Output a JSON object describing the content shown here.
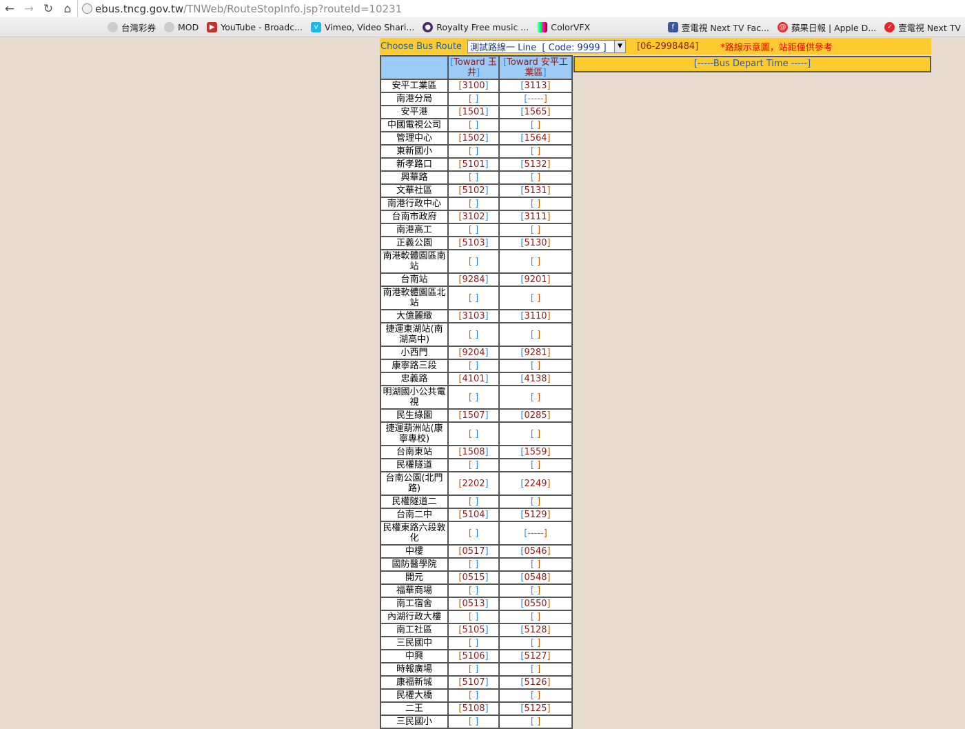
{
  "browser": {
    "url_host": "ebus.tncg.gov.tw",
    "url_path": "/TNWeb/RouteStopInfo.jsp?routeId=10231",
    "bookmarks": [
      "台灣彩券",
      "MOD",
      "YouTube - Broadc...",
      "Vimeo, Video Shari...",
      "Royalty Free music ...",
      "ColorVFX"
    ],
    "bookmarks_right": [
      "壹電視 Next TV Fac...",
      "蘋果日報 | Apple D...",
      "壹電視 Next TV"
    ]
  },
  "topbar": {
    "label": "Choose Bus Route",
    "route_selected": "測試路線一 Line  [ Code: 9999 ]",
    "phone": "[06-2998484]",
    "notice": "*路線示意圖，站距僅供參考"
  },
  "table": {
    "headers": [
      "",
      "Toward 玉井",
      "Toward 安平工業區"
    ],
    "rows": [
      [
        "安平工業區",
        "3100",
        "3113"
      ],
      [
        "南港分局",
        " ",
        "-----"
      ],
      [
        "安平港",
        "1501",
        "1565"
      ],
      [
        "中國電視公司",
        " ",
        " "
      ],
      [
        "管理中心",
        "1502",
        "1564"
      ],
      [
        "東新國小",
        " ",
        " "
      ],
      [
        "新孝路口",
        "5101",
        "5132"
      ],
      [
        "興華路",
        " ",
        " "
      ],
      [
        "文華社區",
        "5102",
        "5131"
      ],
      [
        "南港行政中心",
        " ",
        " "
      ],
      [
        "台南市政府",
        "3102",
        "3111"
      ],
      [
        "南港高工",
        " ",
        " "
      ],
      [
        "正義公園",
        "5103",
        "5130"
      ],
      [
        "南港軟體園區南站",
        " ",
        " "
      ],
      [
        "台南站",
        "9284",
        "9201"
      ],
      [
        "南港軟體園區北站",
        " ",
        " "
      ],
      [
        "大億麗緻",
        "3103",
        "3110"
      ],
      [
        "捷運東湖站(南湖高中)",
        " ",
        " "
      ],
      [
        "小西門",
        "9204",
        "9281"
      ],
      [
        "康寧路三段",
        " ",
        " "
      ],
      [
        "忠義路",
        "4101",
        "4138"
      ],
      [
        "明湖國小公共電視",
        " ",
        " "
      ],
      [
        "民生綠園",
        "1507",
        "0285"
      ],
      [
        "捷運葫洲站(康寧專校)",
        " ",
        " "
      ],
      [
        "台南東站",
        "1508",
        "1559"
      ],
      [
        "民權隧道",
        " ",
        " "
      ],
      [
        "台南公園(北門路)",
        "2202",
        "2249"
      ],
      [
        "民權隧道二",
        " ",
        " "
      ],
      [
        "台南二中",
        "5104",
        "5129"
      ],
      [
        "民權東路六段敦化",
        " ",
        "-----"
      ],
      [
        "中樓",
        "0517",
        "0546"
      ],
      [
        "國防醫學院",
        " ",
        " "
      ],
      [
        "開元",
        "0515",
        "0548"
      ],
      [
        "福華商場",
        " ",
        " "
      ],
      [
        "南工宿舍",
        "0513",
        "0550"
      ],
      [
        "內湖行政大樓",
        " ",
        " "
      ],
      [
        "南工社區",
        "5105",
        "5128"
      ],
      [
        "三民國中",
        " ",
        " "
      ],
      [
        "中興",
        "5106",
        "5127"
      ],
      [
        "時報廣場",
        " ",
        " "
      ],
      [
        "康福新城",
        "5107",
        "5126"
      ],
      [
        "民權大橋",
        " ",
        " "
      ],
      [
        "二王",
        "5108",
        "5125"
      ],
      [
        "三民國小",
        " ",
        " "
      ]
    ]
  },
  "depart": {
    "label": "[-----Bus Depart Time -----]"
  }
}
